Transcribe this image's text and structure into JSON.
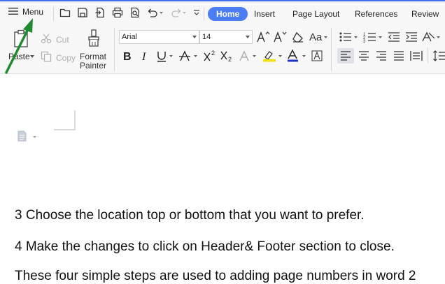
{
  "menu": {
    "label": "Menu"
  },
  "tabs": [
    {
      "label": "Home"
    },
    {
      "label": "Insert"
    },
    {
      "label": "Page Layout"
    },
    {
      "label": "References"
    },
    {
      "label": "Review"
    }
  ],
  "clipboard": {
    "paste": "Paste",
    "cut": "Cut",
    "copy": "Copy",
    "format_painter_line1": "Format",
    "format_painter_line2": "Painter"
  },
  "font": {
    "name": "Arial",
    "size": "14"
  },
  "colors": {
    "accent": "#4a7ef2",
    "highlight": "#f5e100",
    "font_color": "#1d33d6",
    "arrow": "#1f8a2e"
  },
  "document": {
    "lines": [
      "3 Choose the location top or bottom that you want to prefer.",
      "4 Make the changes to click on Header& Footer section to close.",
      "These four simple steps are used to adding page numbers in word 2"
    ]
  }
}
